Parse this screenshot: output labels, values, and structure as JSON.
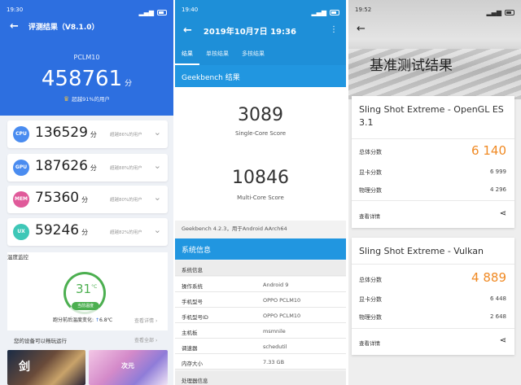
{
  "antutu": {
    "status": {
      "time": "19:30"
    },
    "title": "评测结果（V8.1.0）",
    "model": "PCLM10",
    "total": "458761",
    "unit": "分",
    "beat": "超越91%的用户",
    "colors": {
      "header": "#2d6fe0"
    },
    "scores": [
      {
        "badge": "CPU",
        "value": "136529",
        "unit": "分",
        "beat": "超越86%的用户",
        "color": "#4a8cf0"
      },
      {
        "badge": "GPU",
        "value": "187626",
        "unit": "分",
        "beat": "超越88%的用户",
        "color": "#4a8cf0"
      },
      {
        "badge": "MEM",
        "value": "75360",
        "unit": "分",
        "beat": "超越80%的用户",
        "color": "#e05a9a"
      },
      {
        "badge": "UX",
        "value": "59246",
        "unit": "分",
        "beat": "超越82%的用户",
        "color": "#3ec7b7"
      }
    ],
    "temp": {
      "title": "温度监控",
      "value": "31",
      "unit": "°C",
      "pill": "当前温度",
      "change_label": "跑分前后温度变化:",
      "change_value": "6.8℃",
      "detail": "查看详情"
    },
    "devices": {
      "title": "您的设备可以畅玩运行",
      "more": "查看全部",
      "thumb1_text": "剑",
      "thumb2_text": "次元"
    }
  },
  "geekbench": {
    "status": {
      "time": "19:40"
    },
    "title": "2019年10月7日 19:36",
    "tabs": [
      "结果",
      "单核结果",
      "多核结果"
    ],
    "band": "Geekbench 结果",
    "single_score": "3089",
    "single_label": "Single-Core Score",
    "multi_score": "10846",
    "multi_label": "Multi-Core Score",
    "version": "Geekbench 4.2.3，用于Android AArch64",
    "sys_title": "系统信息",
    "sys_section": "系统信息",
    "sys_rows": [
      {
        "k": "操作系统",
        "v": "Android 9"
      },
      {
        "k": "手机型号",
        "v": "OPPO PCLM10"
      },
      {
        "k": "手机型号ID",
        "v": "OPPO PCLM10"
      },
      {
        "k": "主机板",
        "v": "msmnile"
      },
      {
        "k": "调速器",
        "v": "schedutil"
      },
      {
        "k": "内存大小",
        "v": "7.33 GB"
      }
    ],
    "cpu_section": "处理器信息"
  },
  "threedmark": {
    "status": {
      "time": "19:52"
    },
    "title": "基准测试结果",
    "tests": [
      {
        "name": "Sling Shot Extreme - OpenGL ES 3.1",
        "total_label": "总体分数",
        "total": "6 140",
        "gpu_label": "显卡分数",
        "gpu": "6 999",
        "phys_label": "物理分数",
        "phys": "4 296",
        "detail": "查看详情"
      },
      {
        "name": "Sling Shot Extreme - Vulkan",
        "total_label": "总体分数",
        "total": "4 889",
        "gpu_label": "显卡分数",
        "gpu": "6 448",
        "phys_label": "物理分数",
        "phys": "2 648",
        "detail": "查看详情"
      }
    ],
    "colors": {
      "score": "#f08a24"
    }
  }
}
